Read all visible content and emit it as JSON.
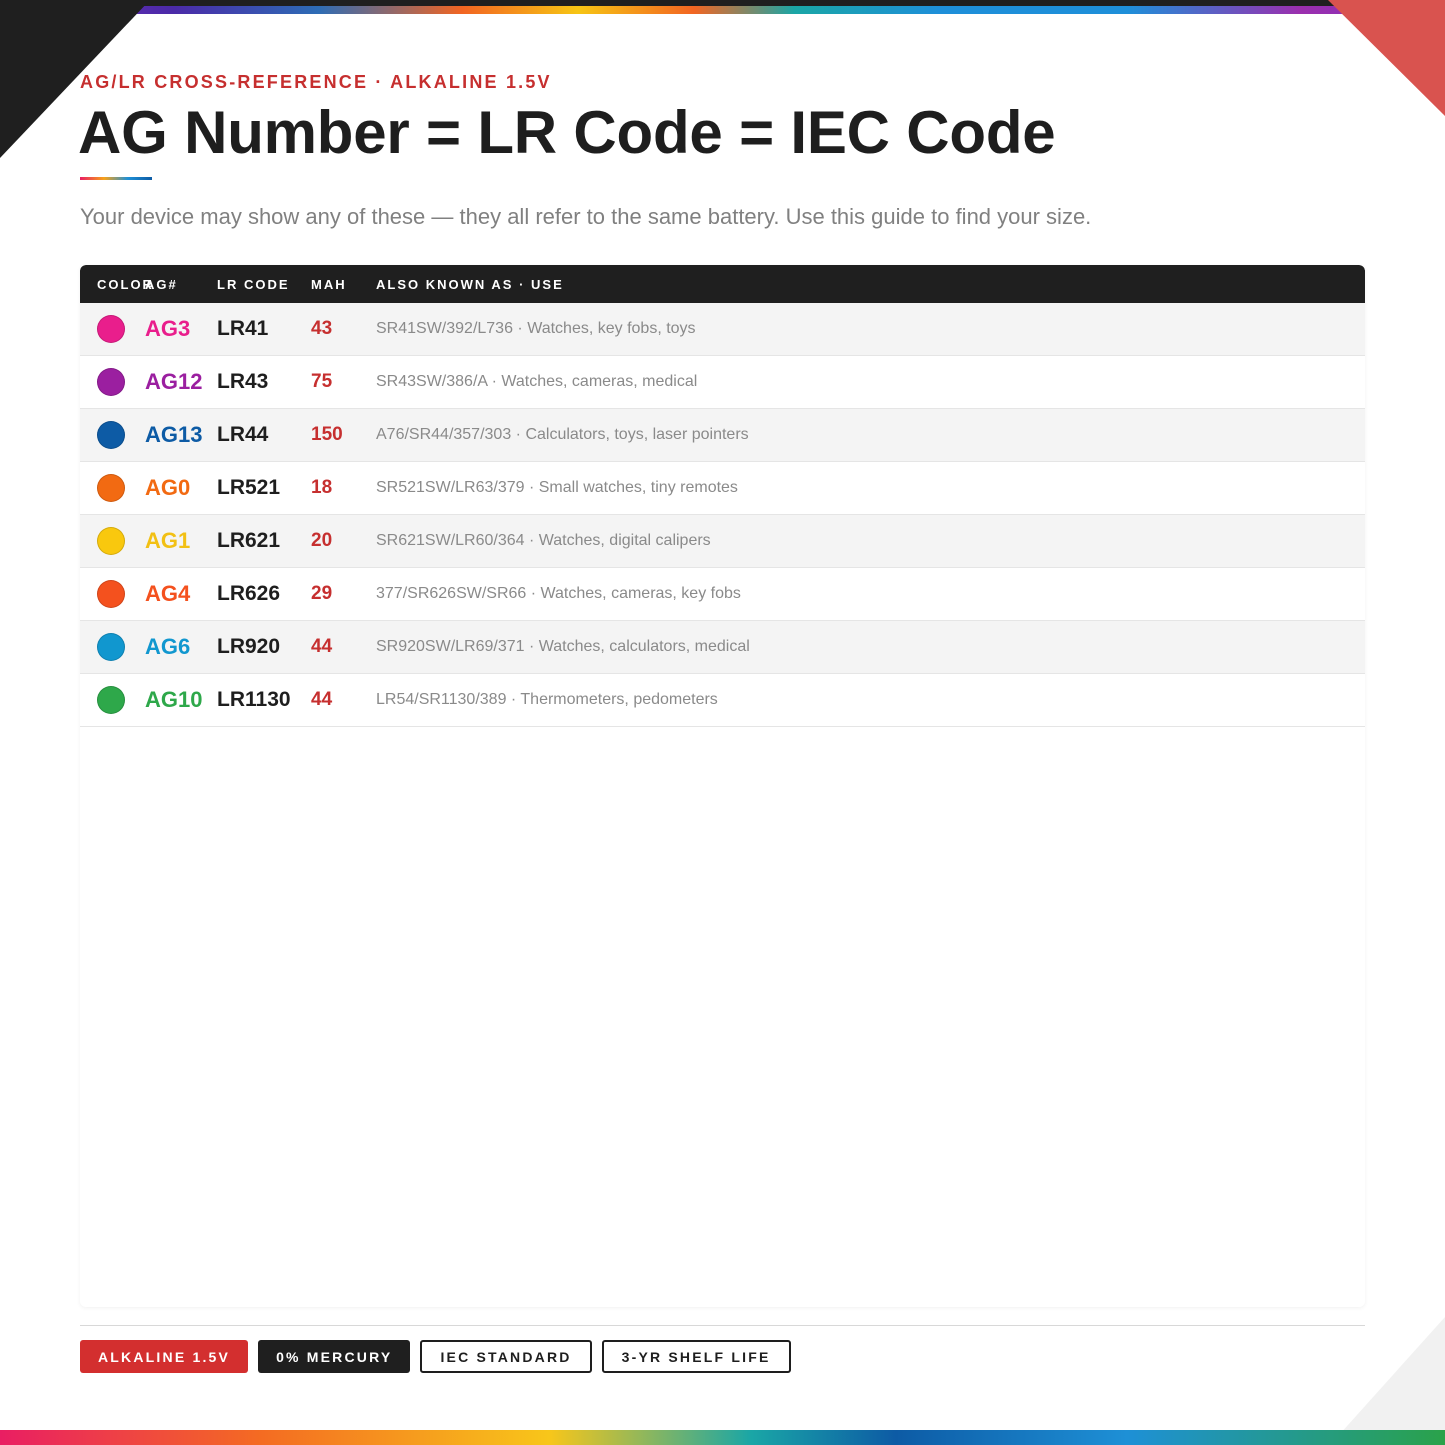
{
  "header": {
    "eyebrow": "AG/LR CROSS-REFERENCE · ALKALINE 1.5V",
    "title": "AG Number = LR Code = IEC Code",
    "subtitle": "Your device may show any of these — they all refer to the same battery. Use this guide to find your size."
  },
  "table": {
    "columns": [
      "COLOR",
      "AG#",
      "LR CODE",
      "MAH",
      "ALSO KNOWN AS · USE"
    ],
    "rows": [
      {
        "color": "#e91e8c",
        "ag": "AG3",
        "lr": "LR41",
        "mah": "43",
        "also": "SR41SW/392/L736 · Watches, key fobs, toys"
      },
      {
        "color": "#9b1fa0",
        "ag": "AG12",
        "lr": "LR43",
        "mah": "75",
        "also": "SR43SW/386/A · Watches, cameras, medical"
      },
      {
        "color": "#0d5ba5",
        "ag": "AG13",
        "lr": "LR44",
        "mah": "150",
        "also": "A76/SR44/357/303 · Calculators, toys, laser pointers"
      },
      {
        "color": "#f26a12",
        "ag": "AG0",
        "lr": "LR521",
        "mah": "18",
        "also": "SR521SW/LR63/379 · Small watches, tiny remotes"
      },
      {
        "color": "#f9c80e",
        "ag": "AG1",
        "lr": "LR621",
        "mah": "20",
        "also": "SR621SW/LR60/364 · Watches, digital calipers"
      },
      {
        "color": "#f4511e",
        "ag": "AG4",
        "lr": "LR626",
        "mah": "29",
        "also": "377/SR626SW/SR66 · Watches, cameras, key fobs"
      },
      {
        "color": "#1197cf",
        "ag": "AG6",
        "lr": "LR920",
        "mah": "44",
        "also": "SR920SW/LR69/371 · Watches, calculators, medical"
      },
      {
        "color": "#2ea84a",
        "ag": "AG10",
        "lr": "LR1130",
        "mah": "44",
        "also": "LR54/SR1130/389 · Thermometers, pedometers"
      }
    ]
  },
  "badges": [
    {
      "label": "ALKALINE 1.5V",
      "style": "red"
    },
    {
      "label": "0% MERCURY",
      "style": "dark"
    },
    {
      "label": "IEC STANDARD",
      "style": "outline"
    },
    {
      "label": "3-YR SHELF LIFE",
      "style": "outline"
    }
  ],
  "colors": {
    "accent_red": "#c62f2f",
    "dark": "#1f1f1f"
  }
}
